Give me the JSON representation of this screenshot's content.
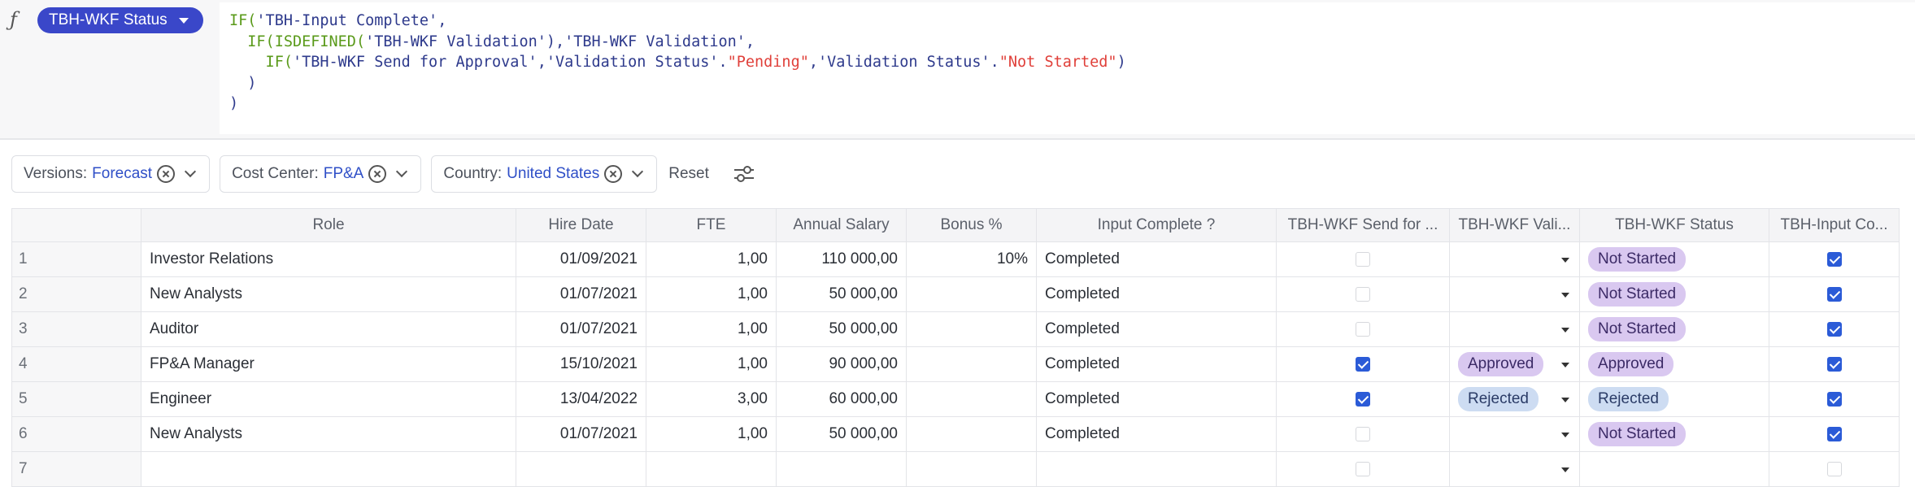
{
  "formula": {
    "column_pill": "TBH-WKF Status",
    "fx_symbol": "ƒ",
    "lines": [
      [
        {
          "t": "IF(",
          "c": "f-fn"
        },
        {
          "t": "'TBH-Input Complete'",
          "c": "f-ref"
        },
        {
          "t": ",",
          "c": "f-ref"
        }
      ],
      [
        {
          "t": "  IF(",
          "c": "f-fn"
        },
        {
          "t": "ISDEFINED(",
          "c": "f-fn"
        },
        {
          "t": "'TBH-WKF Validation'",
          "c": "f-ref"
        },
        {
          "t": "),",
          "c": "f-ref"
        },
        {
          "t": "'TBH-WKF Validation'",
          "c": "f-ref"
        },
        {
          "t": ",",
          "c": "f-ref"
        }
      ],
      [
        {
          "t": "    IF(",
          "c": "f-fn"
        },
        {
          "t": "'TBH-WKF Send for Approval'",
          "c": "f-ref"
        },
        {
          "t": ",",
          "c": "f-ref"
        },
        {
          "t": "'Validation Status'",
          "c": "f-ref"
        },
        {
          "t": ".",
          "c": "f-ref"
        },
        {
          "t": "\"Pending\"",
          "c": "f-str"
        },
        {
          "t": ",",
          "c": "f-ref"
        },
        {
          "t": "'Validation Status'",
          "c": "f-ref"
        },
        {
          "t": ".",
          "c": "f-ref"
        },
        {
          "t": "\"Not Started\"",
          "c": "f-str"
        },
        {
          "t": ")",
          "c": "f-ref"
        }
      ],
      [
        {
          "t": "  )",
          "c": "f-ref"
        }
      ],
      [
        {
          "t": ")",
          "c": "f-ref"
        }
      ]
    ]
  },
  "filters": [
    {
      "label": "Versions:",
      "value": "Forecast"
    },
    {
      "label": "Cost Center:",
      "value": "FP&A"
    },
    {
      "label": "Country:",
      "value": "United States"
    }
  ],
  "reset_label": "Reset",
  "table": {
    "columns": [
      "",
      "Role",
      "Hire Date",
      "FTE",
      "Annual Salary",
      "Bonus %",
      "Input Complete ?",
      "TBH-WKF Send for ...",
      "TBH-WKF Vali...",
      "TBH-WKF Status",
      "TBH-Input Co..."
    ],
    "rows": [
      {
        "idx": "1",
        "role": "Investor Relations",
        "hire": "01/09/2021",
        "fte": "1,00",
        "salary": "110 000,00",
        "bonus": "10%",
        "input": "Completed",
        "send": false,
        "validation": "",
        "status": "Not Started",
        "status_color": "purple",
        "complete": true
      },
      {
        "idx": "2",
        "role": "New Analysts",
        "hire": "01/07/2021",
        "fte": "1,00",
        "salary": "50 000,00",
        "bonus": "",
        "input": "Completed",
        "send": false,
        "validation": "",
        "status": "Not Started",
        "status_color": "purple",
        "complete": true
      },
      {
        "idx": "3",
        "role": "Auditor",
        "hire": "01/07/2021",
        "fte": "1,00",
        "salary": "50 000,00",
        "bonus": "",
        "input": "Completed",
        "send": false,
        "validation": "",
        "status": "Not Started",
        "status_color": "purple",
        "complete": true
      },
      {
        "idx": "4",
        "role": "FP&A Manager",
        "hire": "15/10/2021",
        "fte": "1,00",
        "salary": "90 000,00",
        "bonus": "",
        "input": "Completed",
        "send": true,
        "validation": "Approved",
        "validation_color": "purple",
        "status": "Approved",
        "status_color": "purple",
        "complete": true
      },
      {
        "idx": "5",
        "role": "Engineer",
        "hire": "13/04/2022",
        "fte": "3,00",
        "salary": "60 000,00",
        "bonus": "",
        "input": "Completed",
        "send": true,
        "validation": "Rejected",
        "validation_color": "blue",
        "status": "Rejected",
        "status_color": "blue",
        "complete": true
      },
      {
        "idx": "6",
        "role": "New Analysts",
        "hire": "01/07/2021",
        "fte": "1,00",
        "salary": "50 000,00",
        "bonus": "",
        "input": "Completed",
        "send": false,
        "validation": "",
        "status": "Not Started",
        "status_color": "purple",
        "complete": true
      },
      {
        "idx": "7",
        "role": "",
        "hire": "",
        "fte": "",
        "salary": "",
        "bonus": "",
        "input": "",
        "send": false,
        "validation": "",
        "status": "",
        "status_color": "",
        "complete": false
      }
    ]
  }
}
